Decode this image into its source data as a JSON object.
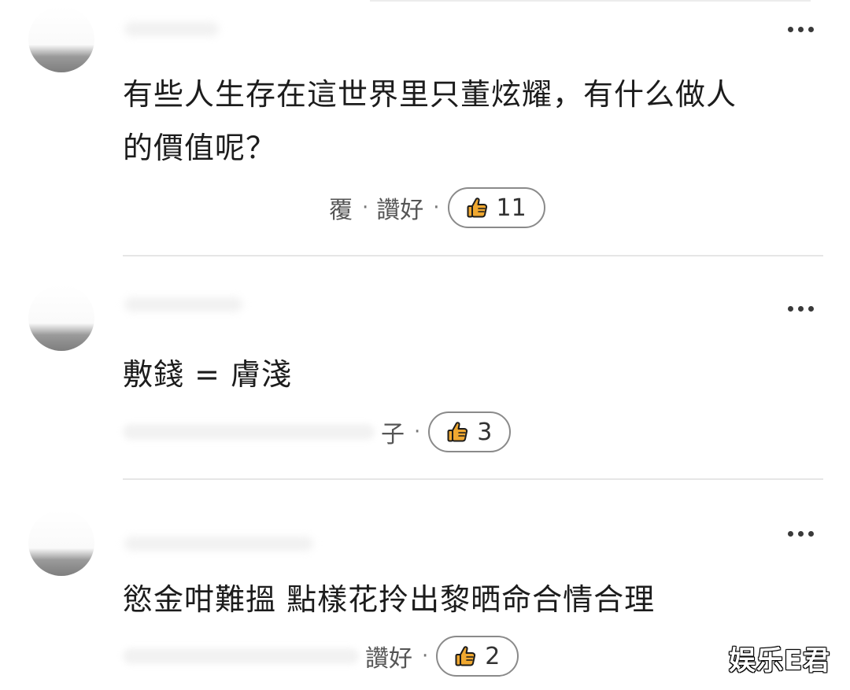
{
  "comments": [
    {
      "text_line1": "有些人生存在這世界里只董炫耀，有什么做人",
      "text_line2": "的價值呢？",
      "time_partial": "覆",
      "like_action": "讚好",
      "separator": "·",
      "like_count": "11"
    },
    {
      "text": "敷錢 = 膚淺",
      "like_action_partial": "子",
      "separator": "·",
      "like_count": "3"
    },
    {
      "text": "慾金咁難搵 點樣花拎出黎晒命合情合理",
      "like_action": "讚好",
      "separator": "·",
      "like_count": "2"
    }
  ],
  "watermark": "娱乐E君",
  "icons": {
    "more": "more-horizontal-icon",
    "like": "thumbs-up-icon"
  },
  "colors": {
    "like_icon_fill": "#f0a830",
    "like_icon_stroke": "#1c1c1c"
  }
}
